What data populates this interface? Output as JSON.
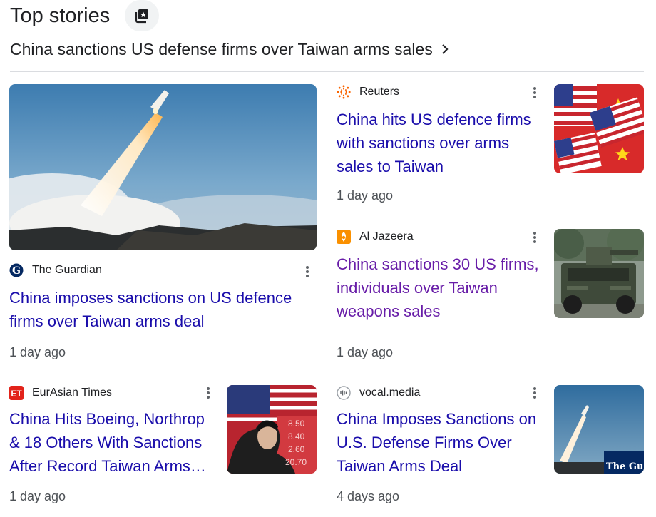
{
  "section": {
    "title": "Top stories"
  },
  "headline": {
    "text": "China sanctions US defense firms over Taiwan arms sales"
  },
  "stories": [
    {
      "source": "The Guardian",
      "title": "China imposes sanctions on US defence firms over Taiwan arms deal",
      "time": "1 day ago"
    },
    {
      "source": "Reuters",
      "title": "China hits US defence firms with sanctions over arms sales to Taiwan",
      "time": "1 day ago"
    },
    {
      "source": "Al Jazeera",
      "title": "China sanctions 30 US firms, individuals over Taiwan weapons sales",
      "time": "1 day ago"
    },
    {
      "source": "EurAsian Times",
      "title": "China Hits Boeing, Northrop & 18 Others With Sanctions After Record Taiwan Arms…",
      "time": "1 day ago"
    },
    {
      "source": "vocal.media",
      "title": "China Imposes Sanctions on U.S. Defense Firms Over Taiwan Arms Deal",
      "time": "4 days ago"
    }
  ],
  "thumb_text": {
    "stock_values": [
      "8.50",
      "8.40",
      "2.60",
      "20.70"
    ],
    "guardian_logo": "The Guardi"
  },
  "colors": {
    "link": "#1a0dab",
    "visited": "#681da8",
    "meta": "#4d5156",
    "divider": "#dadce0"
  }
}
